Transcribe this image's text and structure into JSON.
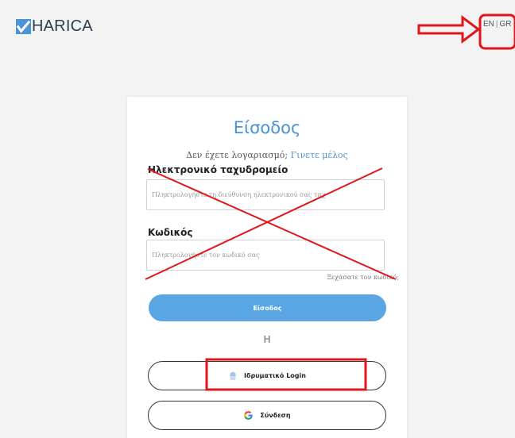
{
  "header": {
    "brand": "HARICA",
    "lang_en": "EN",
    "lang_separator": "|",
    "lang_gr": "GR"
  },
  "login": {
    "title": "Είσοδος",
    "no_account_text": "Δεν έχετε λογαριασμό;",
    "signup_link": "Γινετε μέλος",
    "email_label": "Ηλεκτρονικό ταχυδρομείο",
    "email_placeholder": "Πληκτρολογήστε τη διεύθυνση ηλεκτρονικού σας ταχ",
    "password_label": "Κωδικός",
    "password_placeholder": "Πληκτρολογήστε τον κωδικό σας",
    "forgot_password": "Ξεχάσατε τον κωδικό;",
    "submit_button": "Είσοδος",
    "or_text": "Η",
    "institutional_login": "Ιδρυματικό Login",
    "google_login": "Σύνδεση"
  },
  "colors": {
    "accent": "#4a93d6",
    "button": "#5aa6e5",
    "annotation": "#e0161b"
  },
  "icons": {
    "institution": "institution-icon",
    "google": "google-icon",
    "arrow": "red-arrow-annotation"
  }
}
